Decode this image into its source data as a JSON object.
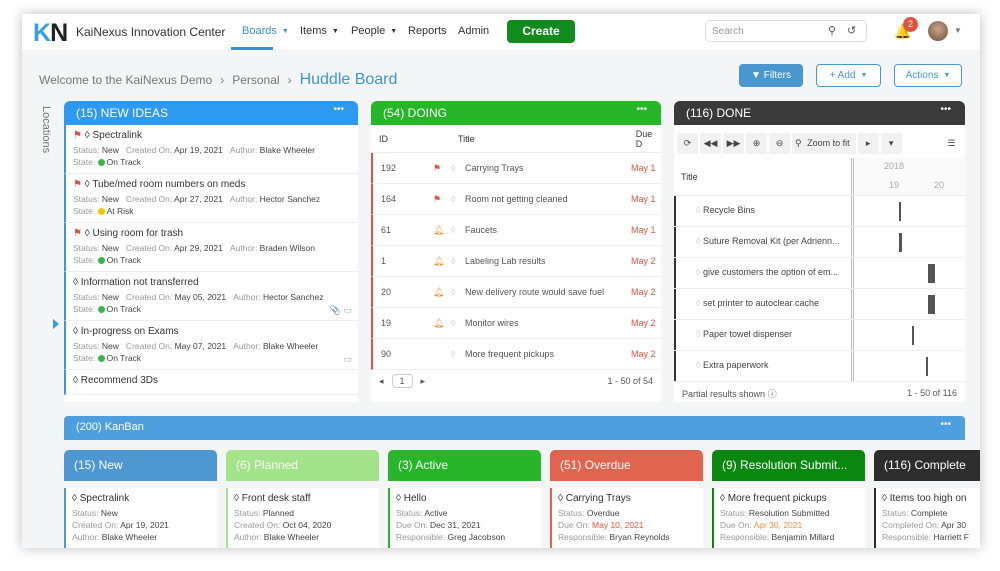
{
  "nav": {
    "logo": "KN",
    "app_title": "KaiNexus Innovation Center",
    "items": [
      {
        "label": "Boards"
      },
      {
        "label": "Items"
      },
      {
        "label": "People"
      },
      {
        "label": "Reports"
      },
      {
        "label": "Admin"
      }
    ],
    "create": "Create",
    "search_placeholder": "Search",
    "notifications": "2",
    "active_color": "#3c8fd0"
  },
  "breadcrumb": [
    "Welcome to the KaiNexus Demo",
    "Personal",
    "Huddle Board"
  ],
  "toolbar": {
    "filters": "Filters",
    "add": "Add",
    "actions": "Actions"
  },
  "sidebar_label": "Locations",
  "new_ideas": {
    "title": "(15) NEW IDEAS",
    "color": "#2d9af0",
    "cards": [
      {
        "title": "Spectralink",
        "flag": true,
        "status": "New",
        "created": "Apr 19, 2021",
        "author": "Blake Wheeler",
        "state": "On Track",
        "state_color": "#3cb54a"
      },
      {
        "title": "Tube/med room numbers on meds",
        "flag": true,
        "status": "New",
        "created": "Apr 27, 2021",
        "author": "Hector Sanchez",
        "state": "At Risk",
        "state_color": "#f5c400"
      },
      {
        "title": "Using room for trash",
        "flag": true,
        "status": "New",
        "created": "Apr 29, 2021",
        "author": "Braden Wilson",
        "state": "On Track",
        "state_color": "#3cb54a"
      },
      {
        "title": "Information not transferred",
        "flag": false,
        "status": "New",
        "created": "May 05, 2021",
        "author": "Hector Sanchez",
        "state": "On Track",
        "state_color": "#3cb54a"
      },
      {
        "title": "In-progress on Exams",
        "flag": false,
        "status": "New",
        "created": "May 07, 2021",
        "author": "Blake Wheeler",
        "state": "On Track",
        "state_color": "#3cb54a"
      },
      {
        "title": "Recommend 3Ds",
        "flag": false
      }
    ],
    "labels": {
      "status": "Status:",
      "created": "Created On:",
      "author": "Author:",
      "state": "State:"
    }
  },
  "doing": {
    "title": "(54) DOING",
    "color": "#27b52a",
    "columns": [
      "ID",
      "Title",
      "Due D"
    ],
    "rows": [
      {
        "id": "192",
        "icon": "flag",
        "title": "Carrying Trays",
        "due": "May 1"
      },
      {
        "id": "164",
        "icon": "flag",
        "title": "Room not getting cleaned",
        "due": "May 1"
      },
      {
        "id": "61",
        "icon": "bell",
        "title": "Faucets",
        "due": "May 1"
      },
      {
        "id": "1",
        "icon": "bell",
        "title": "Labeling Lab results",
        "due": "May 2"
      },
      {
        "id": "20",
        "icon": "bell",
        "title": "New delivery route would save fuel",
        "due": "May 2"
      },
      {
        "id": "19",
        "icon": "bell",
        "title": "Monitor wires",
        "due": "May 2"
      },
      {
        "id": "90",
        "icon": "",
        "title": "More frequent pickups",
        "due": "May 2"
      }
    ],
    "page": "1",
    "range": "1 - 50 of 54"
  },
  "done": {
    "title": "(116) DONE",
    "color": "#3a3a3a",
    "zoom_to_fit": "Zoom to fit",
    "title_col": "Title",
    "year": "2018",
    "days": [
      "19",
      "20"
    ],
    "rows": [
      {
        "title": "Recycle Bins",
        "start": 19.15,
        "end": 19.2
      },
      {
        "title": "Suture Removal Kit (per Adrienn...",
        "start": 19.17,
        "end": 19.22
      },
      {
        "title": "give customers the option of em...",
        "start": 19.82,
        "end": 19.97
      },
      {
        "title": "set printer to autoclear cache",
        "start": 19.82,
        "end": 19.97
      },
      {
        "title": "Paper towel dispenser",
        "start": 19.45,
        "end": 19.48
      },
      {
        "title": "Extra paperwork",
        "start": 19.78,
        "end": 19.8
      }
    ],
    "partial": "Partial results shown",
    "range": "1 - 50 of 116"
  },
  "kanban": {
    "title": "(200) KanBan",
    "columns": [
      {
        "header": "(15) New",
        "color": "#4e97d0",
        "card": "Spectralink",
        "l1": "Status:",
        "v1": "New",
        "l2": "Created On:",
        "v2": "Apr 19, 2021",
        "l3": "Author:",
        "v3": "Blake Wheeler"
      },
      {
        "header": "(6) Planned",
        "color": "#a3e38a",
        "card": "Front desk staff",
        "l1": "Status:",
        "v1": "Planned",
        "l2": "Created On:",
        "v2": "Oct 04, 2020",
        "l3": "Author:",
        "v3": "Blake Wheeler"
      },
      {
        "header": "(3) Active",
        "color": "#27b52a",
        "card": "Hello",
        "l1": "Status:",
        "v1": "Active",
        "l2": "Due On:",
        "v2": "Dec 31, 2021",
        "l3": "Responsible:",
        "v3": "Greg Jacobson"
      },
      {
        "header": "(51) Overdue",
        "color": "#e0644e",
        "card": "Carrying Trays",
        "l1": "Status:",
        "v1": "Overdue",
        "l2": "Due On:",
        "v2": "May 10, 2021",
        "v2color": "#e0533e",
        "l3": "Responsible:",
        "v3": "Bryan Reynolds"
      },
      {
        "header": "(9) Resolution Submit...",
        "color": "#0a870f",
        "card": "More frequent pickups",
        "l1": "Status:",
        "v1": "Resolution Submitted",
        "l2": "Due On:",
        "v2": "Apr 30, 2021",
        "v2color": "#f0903a",
        "l3": "Responsible:",
        "v3": "Benjamin Millard"
      },
      {
        "header": "(116) Complete",
        "color": "#2d2d2d",
        "card": "Items too high on",
        "l1": "Status:",
        "v1": "Complete",
        "l2": "Completed On:",
        "v2": "Apr 30",
        "l3": "Responsible:",
        "v3": "Harriett F"
      }
    ]
  }
}
